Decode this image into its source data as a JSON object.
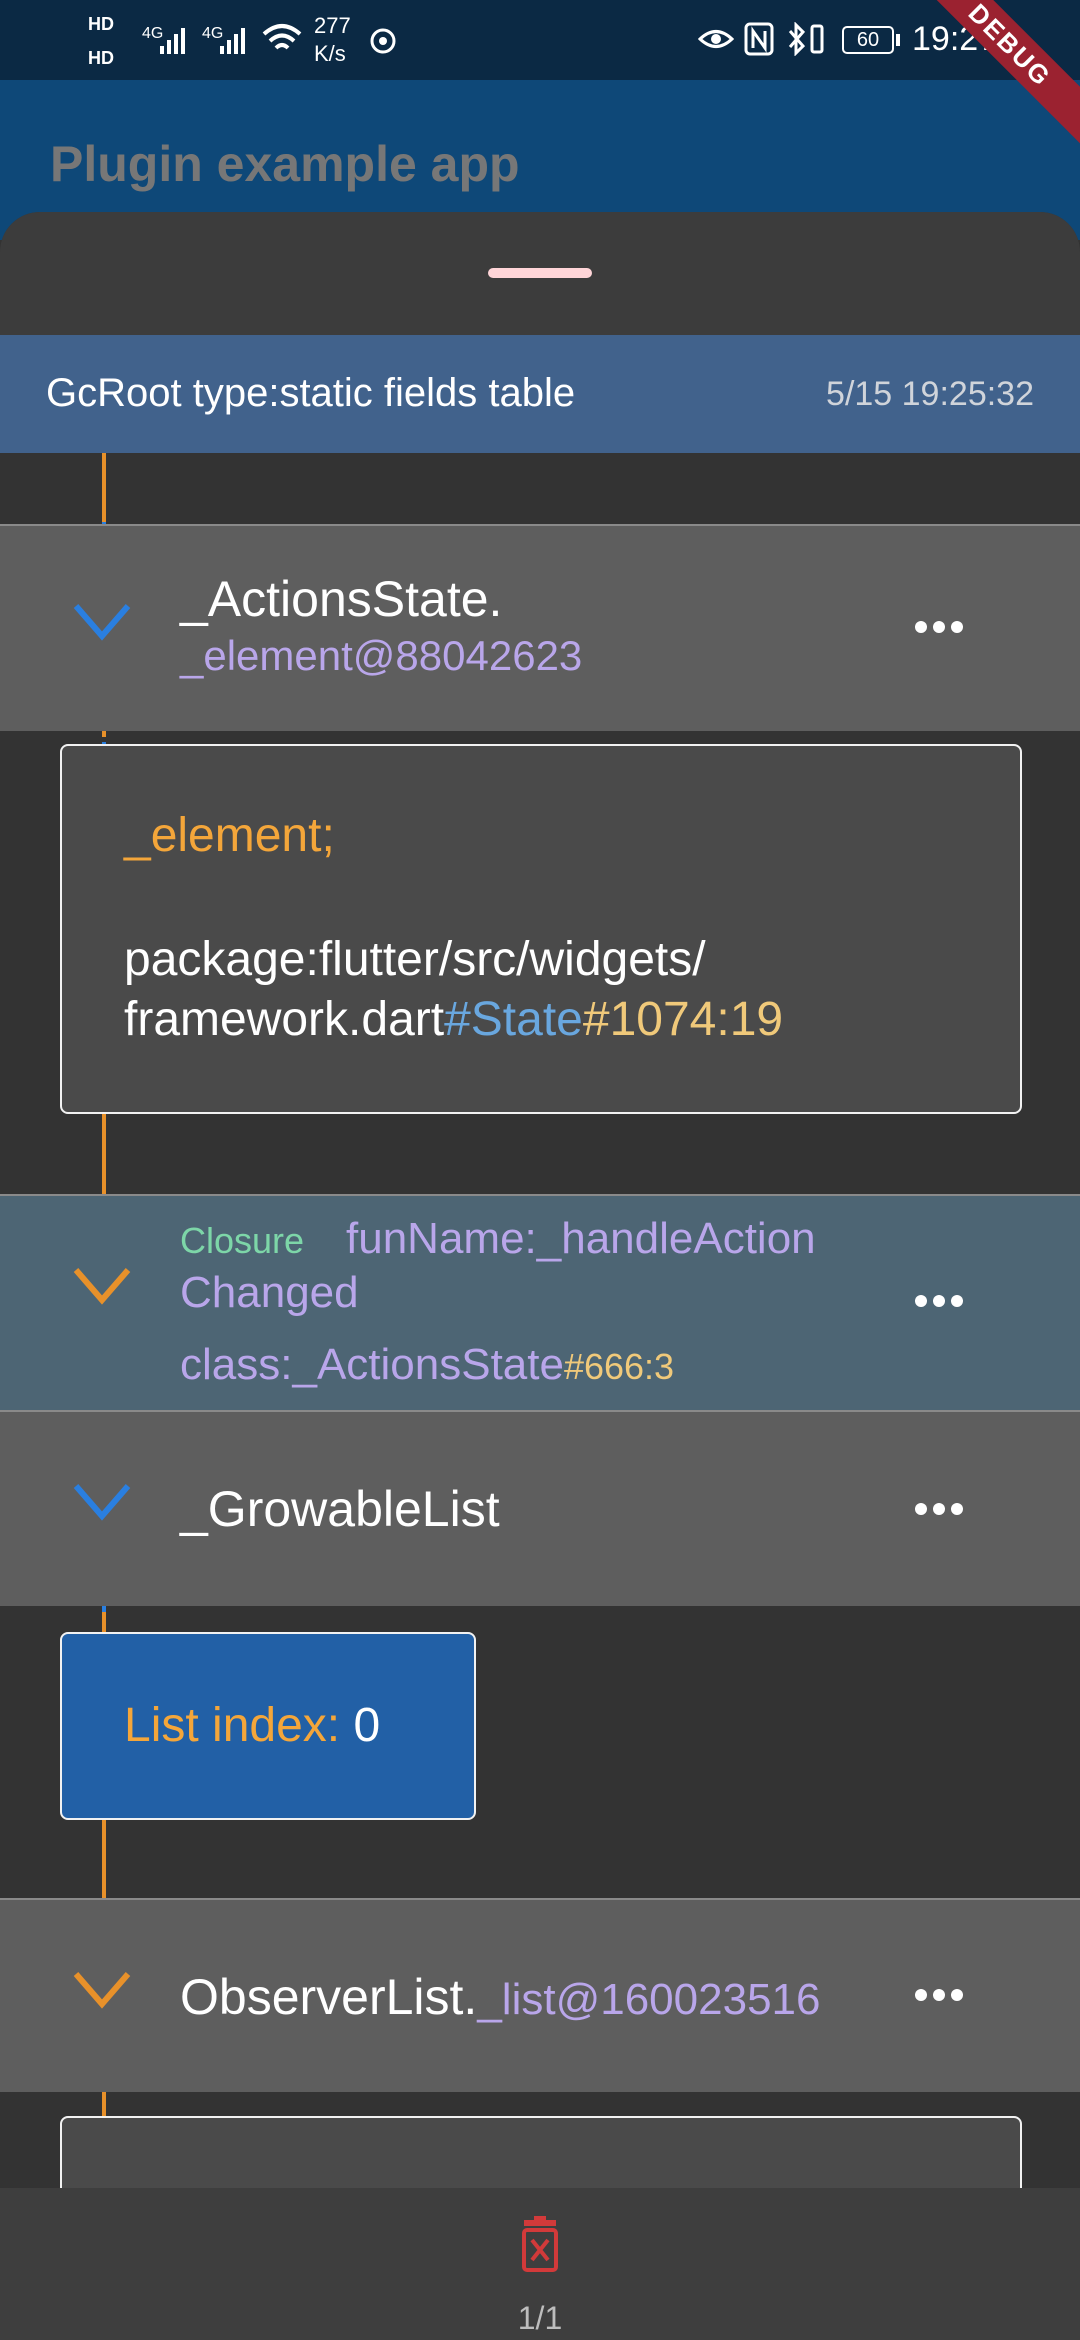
{
  "status_bar": {
    "hd1": "HD",
    "hd2": "HD",
    "signal1": "4G",
    "signal2": "4G",
    "speed_value": "277",
    "speed_unit": "K/s",
    "battery": "60",
    "time": "19:27"
  },
  "app_bar": {
    "title": "Plugin example app"
  },
  "debug_banner": "DEBUG",
  "gcroot": {
    "title": "GcRoot type:static fields table",
    "time": "5/15 19:25:32"
  },
  "items": [
    {
      "line1": "_ActionsState.",
      "line2": "_element@88042623"
    },
    {
      "closure_tag": "Closure",
      "fun_name_line1": "funName:_handleAction",
      "fun_name_line2": "Changed",
      "class_label": "class:_ActionsState",
      "class_loc": "#666:3"
    },
    {
      "label": "_GrowableList"
    },
    {
      "prefix": "ObserverList.",
      "suffix": "_list@160023516"
    }
  ],
  "cards": [
    {
      "field": "_element;",
      "path_line1": "package:flutter/src/widgets/",
      "path_file": "framework.dart",
      "path_class": "#State",
      "path_loc": "#1074:19"
    },
    {
      "label": "List index: ",
      "value": "0"
    }
  ],
  "bottom": {
    "page_count": "1/1",
    "icon": "delete-x-icon"
  },
  "colors": {
    "appbar": "#0e4878",
    "gcroot_bar": "#41628c",
    "line_blue": "#2a7fe0",
    "line_orange": "#e8912a"
  }
}
